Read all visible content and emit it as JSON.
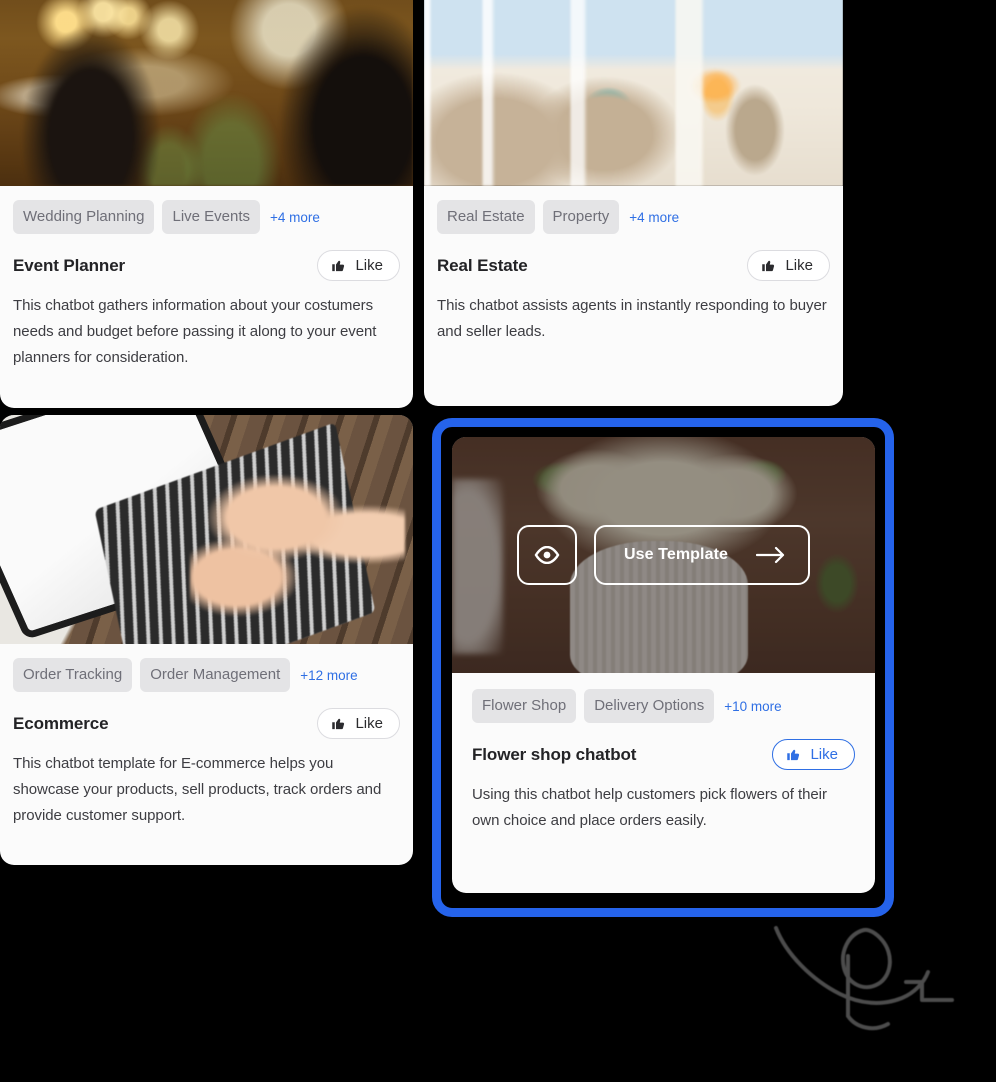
{
  "page": {
    "background_color": "#000000",
    "accent_color": "#2563eb",
    "tag_bg_color": "#e4e4e6",
    "link_color": "#2f6fe4"
  },
  "cards": [
    {
      "id": "event-planner",
      "tags": [
        "Wedding Planning",
        "Live Events"
      ],
      "more_label": "+4 more",
      "title": "Event Planner",
      "like_label": "Like",
      "liked": false,
      "description": "This chatbot gathers information about your costumers needs and budget before passing it along to your event planners for consideration.",
      "image_alt": "wedding-toast-photo",
      "selected": false
    },
    {
      "id": "real-estate",
      "tags": [
        "Real Estate",
        "Property"
      ],
      "more_label": "+4 more",
      "title": "Real Estate",
      "like_label": "Like",
      "liked": false,
      "description": "This chatbot assists agents in instantly responding to buyer and seller leads.",
      "image_alt": "living-room-photo",
      "selected": false
    },
    {
      "id": "ecommerce",
      "tags": [
        "Order Tracking",
        "Order Management"
      ],
      "more_label": "+12 more",
      "title": "Ecommerce",
      "like_label": "Like",
      "liked": false,
      "description": "This chatbot template for E-commerce helps you showcase your products, sell products, track orders and provide customer support.",
      "image_alt": "laptop-typing-photo",
      "selected": false
    },
    {
      "id": "flower-shop",
      "tags": [
        "Flower Shop",
        "Delivery Options"
      ],
      "more_label": "+10 more",
      "title": "Flower shop chatbot",
      "like_label": "Like",
      "liked": true,
      "description": "Using this chatbot help customers pick flowers of their own choice and place orders easily.",
      "image_alt": "white-flowers-vase-photo",
      "selected": true,
      "overlay": {
        "preview_icon": "eye-icon",
        "use_template_label": "Use Template",
        "arrow_icon": "arrow-right-icon"
      }
    }
  ]
}
